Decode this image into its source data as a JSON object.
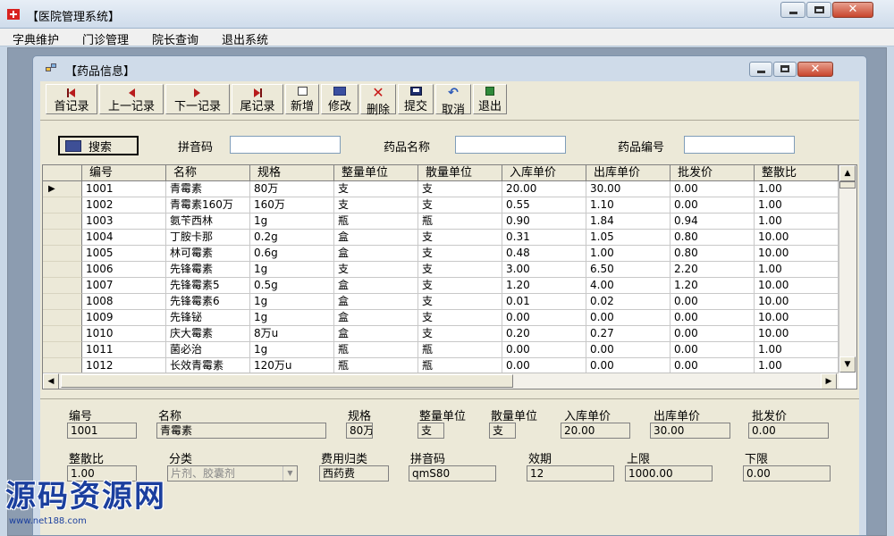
{
  "app": {
    "title": "【医院管理系统】"
  },
  "menu": [
    "字典维护",
    "门诊管理",
    "院长查询",
    "退出系统"
  ],
  "child": {
    "title": "【药品信息】"
  },
  "toolbar": [
    {
      "name": "first-record-button",
      "icon": "first-record-icon",
      "cls": "i-first",
      "label": "首记录"
    },
    {
      "name": "prev-record-button",
      "icon": "prev-record-icon",
      "cls": "i-prev",
      "label": "上一记录"
    },
    {
      "name": "next-record-button",
      "icon": "next-record-icon",
      "cls": "i-next",
      "label": "下一记录"
    },
    {
      "name": "last-record-button",
      "icon": "last-record-icon",
      "cls": "i-last",
      "label": "尾记录"
    },
    {
      "name": "new-button",
      "icon": "new-document-icon",
      "cls": "i-new",
      "label": "新增"
    },
    {
      "name": "edit-button",
      "icon": "edit-icon",
      "cls": "i-edit",
      "label": "修改"
    },
    {
      "name": "delete-button",
      "icon": "delete-icon",
      "cls": "i-delete",
      "label": "删除"
    },
    {
      "name": "submit-button",
      "icon": "save-icon",
      "cls": "i-submit",
      "label": "提交"
    },
    {
      "name": "cancel-button",
      "icon": "undo-icon",
      "cls": "i-cancel",
      "label": "取消"
    },
    {
      "name": "exit-button",
      "icon": "exit-icon",
      "cls": "i-exit",
      "label": "退出"
    }
  ],
  "search": {
    "button": "搜索",
    "pinyin_label": "拼音码",
    "pinyin_value": "",
    "name_label": "药品名称",
    "name_value": "",
    "code_label": "药品编号",
    "code_value": ""
  },
  "grid": {
    "columns": [
      "编号",
      "名称",
      "规格",
      "整量单位",
      "散量单位",
      "入库单价",
      "出库单价",
      "批发价",
      "整散比"
    ],
    "current_marker": "▶",
    "rows": [
      [
        "1001",
        "青霉素",
        "80万",
        "支",
        "支",
        "20.00",
        "30.00",
        "0.00",
        "1.00"
      ],
      [
        "1002",
        "青霉素160万",
        "160万",
        "支",
        "支",
        "0.55",
        "1.10",
        "0.00",
        "1.00"
      ],
      [
        "1003",
        "氨苄西林",
        "1g",
        "瓶",
        "瓶",
        "0.90",
        "1.84",
        "0.94",
        "1.00"
      ],
      [
        "1004",
        "丁胺卡那",
        "0.2g",
        "盒",
        "支",
        "0.31",
        "1.05",
        "0.80",
        "10.00"
      ],
      [
        "1005",
        "林可霉素",
        "0.6g",
        "盒",
        "支",
        "0.48",
        "1.00",
        "0.80",
        "10.00"
      ],
      [
        "1006",
        "先锋霉素",
        "1g",
        "支",
        "支",
        "3.00",
        "6.50",
        "2.20",
        "1.00"
      ],
      [
        "1007",
        "先锋霉素5",
        "0.5g",
        "盒",
        "支",
        "1.20",
        "4.00",
        "1.20",
        "10.00"
      ],
      [
        "1008",
        "先锋霉素6",
        "1g",
        "盒",
        "支",
        "0.01",
        "0.02",
        "0.00",
        "10.00"
      ],
      [
        "1009",
        "先锋铋",
        "1g",
        "盒",
        "支",
        "0.00",
        "0.00",
        "0.00",
        "10.00"
      ],
      [
        "1010",
        "庆大霉素",
        "8万u",
        "盒",
        "支",
        "0.20",
        "0.27",
        "0.00",
        "10.00"
      ],
      [
        "1011",
        "菌必治",
        "1g",
        "瓶",
        "瓶",
        "0.00",
        "0.00",
        "0.00",
        "1.00"
      ],
      [
        "1012",
        "长效青霉素",
        "120万u",
        "瓶",
        "瓶",
        "0.00",
        "0.00",
        "0.00",
        "1.00"
      ]
    ]
  },
  "detail": {
    "code_label": "编号",
    "code": "1001",
    "name_label": "名称",
    "name": "青霉素",
    "spec_label": "规格",
    "spec": "80万",
    "unit_label": "整量单位",
    "unit": "支",
    "loose_unit_label": "散量单位",
    "loose_unit": "支",
    "in_price_label": "入库单价",
    "in_price": "20.00",
    "out_price_label": "出库单价",
    "out_price": "30.00",
    "wholesale_label": "批发价",
    "wholesale": "0.00",
    "ratio_label": "整散比",
    "ratio": "1.00",
    "category_label": "分类",
    "category": "片剂、胶囊剂",
    "fee_label": "费用归类",
    "fee": "西药费",
    "pinyin_label": "拼音码",
    "pinyin": "qmS80",
    "validity_label": "效期",
    "validity": "12",
    "upper_label": "上限",
    "upper": "1000.00",
    "lower_label": "下限",
    "lower": "0.00"
  },
  "watermark": {
    "title": "源码资源网",
    "url": "www.net188.com"
  }
}
